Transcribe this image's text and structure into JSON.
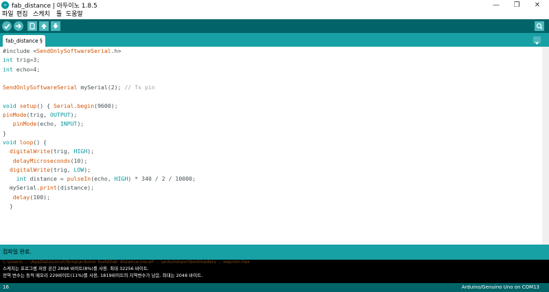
{
  "window": {
    "title": "fab_distance | 아두이노 1.8.5",
    "app_icon_text": "∞",
    "controls": {
      "minimize": "—",
      "maximize": "❐",
      "close": "✕"
    }
  },
  "menu": {
    "items": [
      "파일",
      "편집",
      "스케치",
      "툴",
      "도움말"
    ]
  },
  "toolbar": {
    "buttons": [
      "verify-icon",
      "upload-icon",
      "new-icon",
      "open-icon",
      "save-icon"
    ],
    "serial_monitor_icon": "serial-monitor-icon"
  },
  "tab": {
    "label": "fab_distance §"
  },
  "code": {
    "lines": [
      "#include <SendOnlySoftwareSerial.h>",
      "int trig=3;",
      "int echo=4;",
      "",
      "SendOnlySoftwareSerial mySerial(2); // Tx pin",
      "",
      "void setup() { Serial.begin(9600);",
      "pinMode(trig, OUTPUT);",
      "   pinMode(echo, INPUT);",
      "}",
      "void loop() {",
      "  digitalWrite(trig, HIGH);",
      "   delayMicroseconds(10);",
      "  digitalWrite(trig, LOW);",
      "    int distance = pulseIn(echo, HIGH) * 340 / 2 / 10000;",
      "  mySerial.print(distance);",
      "   delay(100);",
      "  }"
    ]
  },
  "message": {
    "text": "컴파일 완료."
  },
  "console": {
    "faded": "C:\\Users\\ ... \\AppData\\Local\\Temp\\arduino_build\\fab_distance.ino.elf ... \\arduino\\avr\\bootloaders ... eeprom.hex",
    "line1": "스케치는 프로그램 저장 공간 2898 바이트(8%)를 사용. 최대 32256 바이트.",
    "line2": "전역 변수는 동적 메모리 229바이트(11%)를 사용, 1819바이트의 지역변수가 남음.  최대는 2048 바이트."
  },
  "status": {
    "line_number": "16",
    "board": "Arduino/Genuino Uno on COM13"
  },
  "colors": {
    "toolbar_bg": "#006468",
    "tabbar_bg": "#17a1a5",
    "button_bg": "#4db7bb",
    "keyword": "#00979c",
    "function": "#d35400",
    "comment": "#95a5a6"
  }
}
